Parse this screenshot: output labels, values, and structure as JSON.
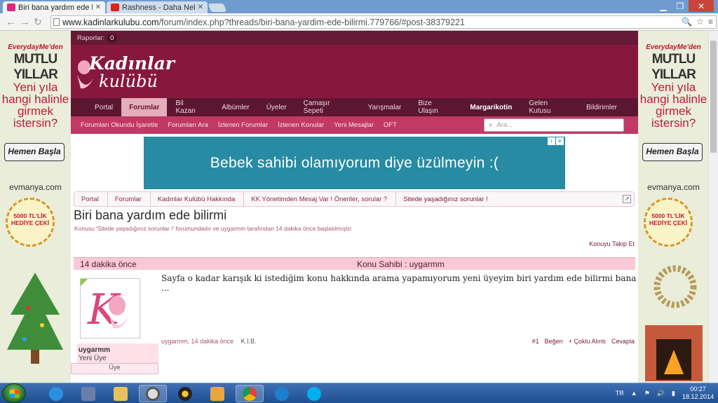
{
  "browser": {
    "tabs": [
      {
        "title": "Biri bana yardım ede bilirmi",
        "active": true,
        "favicon_color": "#e0267e"
      },
      {
        "title": "Rashness - Daha Neler",
        "active": false,
        "favicon_color": "#e62117"
      }
    ],
    "url_domain": "www.kadinlarkulubu.com",
    "url_path": "/forum/index.php?threads/biri-bana-yardim-ede-bilirmi.779766/#post-38379221"
  },
  "side_banner": {
    "line1": "EverydayMe'den",
    "line2": "MUTLU YILLAR",
    "line3": "Yeni yıla hangi halinle girmek istersin?",
    "button": "Hemen Başla",
    "brand": "evmanya.com",
    "badge": "5000 TL'LİK HEDİYE ÇEKİ"
  },
  "site": {
    "reports_label": "Raporlar:",
    "reports_count": "0",
    "logo_line1": "Kadınlar",
    "logo_line2": "kulübü",
    "main_nav": [
      "Portal",
      "Forumlar",
      "Bil Kazan",
      "Albümler",
      "Üyeler",
      "Çamaşır Sepeti",
      "Yarışmalar",
      "Bize Ulaşın"
    ],
    "selected_nav": "Forumlar",
    "user_nav": [
      "Margarikotin",
      "Gelen Kutusu",
      "Bildirimler"
    ],
    "sub_nav": [
      "Forumları Okundu İşaretle",
      "Forumları Ara",
      "İzlenen Forumlar",
      "İzlenen Konular",
      "Yeni Mesajlar",
      "OFT"
    ],
    "search_placeholder": "Ara..."
  },
  "ad": {
    "text": "Bebek sahibi olamıyorum diye üzülmeyin :("
  },
  "breadcrumbs": [
    "Portal",
    "Forumlar",
    "Kadınlar Kulübü Hakkında",
    "KK Yönetimden Mesaj Var ! Öneriler, sorular ?",
    "Sitede yaşadığınız sorunlar !"
  ],
  "thread": {
    "title": "Biri bana yardım ede bilirmi",
    "subtitle": "Konusu 'Sitede yaşadığınız sorunlar !' forumundadır ve uygarmm tarafından 14 dakika önce başlatılmıştır.",
    "follow": "Konuyu Takip Et"
  },
  "post": {
    "time_ago": "14 dakika önce",
    "owner_label": "Konu Sahibi : uygarmm",
    "username": "uygarmm",
    "rank": "Yeni Üye",
    "member_badge": "Üye",
    "message": "Sayfa o kadar karışık ki istediğim konu hakkında arama yapamıyorum yeni üyeyim biri yardım ede bilirmi bana ...",
    "meta_author": "uygarmm, 14 dakika önce",
    "meta_extra": "K.İ.B.",
    "post_number": "#1",
    "like": "Beğen",
    "multi_quote": "+ Çoklu Alıntı",
    "reply": "Cevapla"
  },
  "taskbar": {
    "lang": "TR",
    "time": "00:27",
    "date": "18.12.2014"
  }
}
